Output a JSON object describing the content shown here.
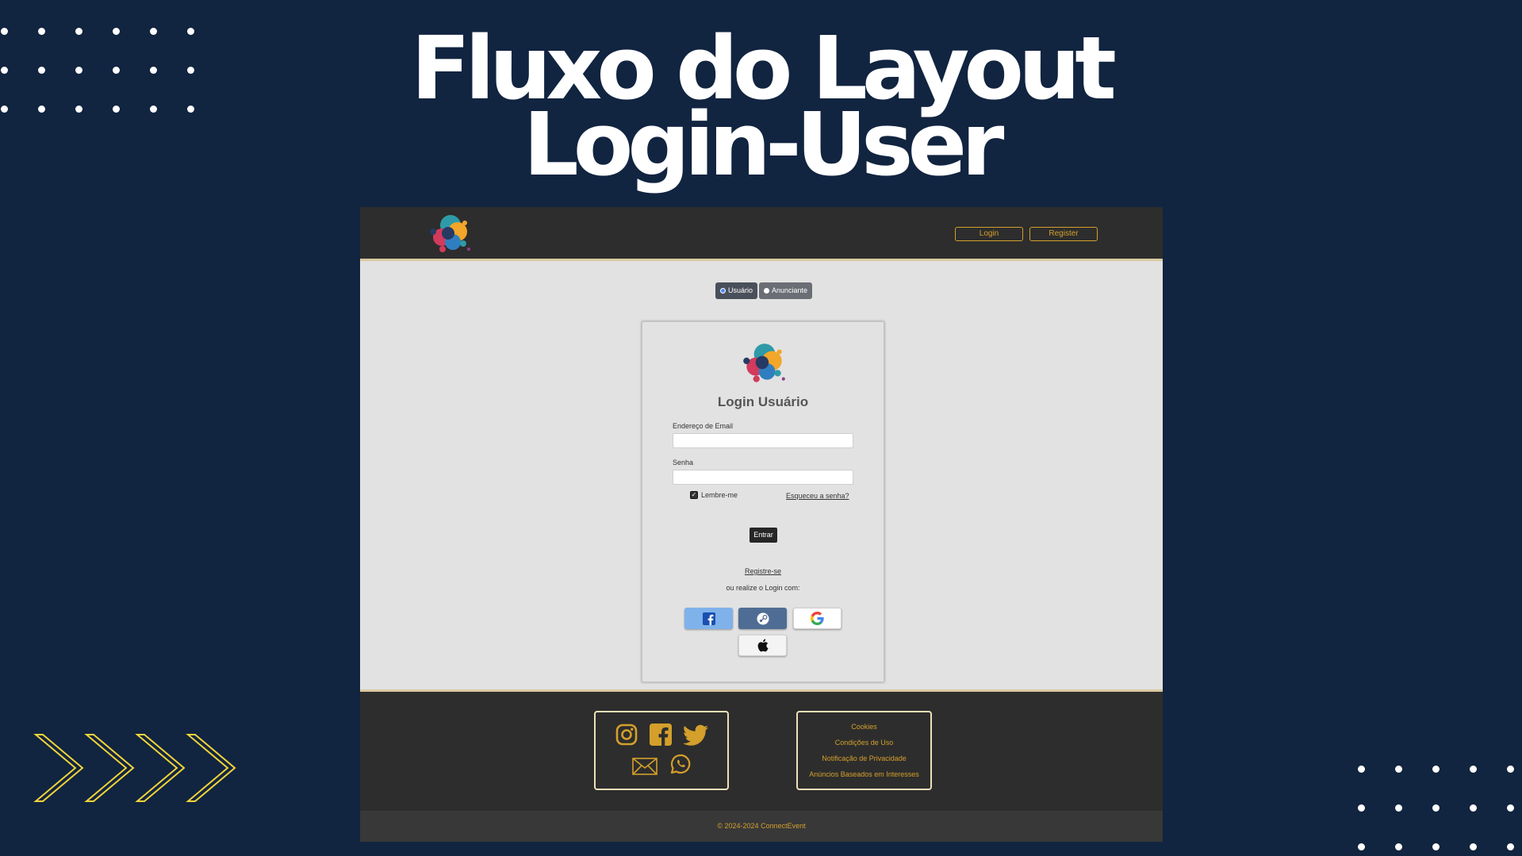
{
  "headline": {
    "line1": "Fluxo do Layout",
    "line2": "Login-User"
  },
  "navbar": {
    "logo_icon": "connectevent-logo",
    "login_label": "Login",
    "register_label": "Register"
  },
  "user_type": {
    "options": [
      "Usuário",
      "Anunciante"
    ],
    "selected": "Usuário"
  },
  "login_card": {
    "title": "Login Usuário",
    "email_label": "Endereço de Email",
    "email_value": "",
    "password_label": "Senha",
    "password_value": "",
    "remember_label": "Lembre-me",
    "remember_checked": true,
    "forgot_label": "Esqueceu a senha?",
    "submit_label": "Entrar",
    "register_label": "Registre-se",
    "alt_login_text": "ou realize o Login com:",
    "social_icons": [
      "facebook-icon",
      "steam-icon",
      "google-icon",
      "apple-icon"
    ]
  },
  "footer": {
    "social_icons": [
      "instagram-icon",
      "facebook-icon",
      "twitter-icon",
      "mail-icon",
      "whatsapp-icon"
    ],
    "links": [
      "Cookies",
      "Condições de Uso",
      "Notificação de Privacidade",
      "Anúncios Baseados em Interesses"
    ],
    "copyright": "© 2024-2024 ConnectEvent"
  },
  "colors": {
    "background": "#112440",
    "bar": "#2d2d2d",
    "accent": "#d4a02b",
    "content": "#e2e2e2",
    "chevron": "#f2d43a"
  }
}
